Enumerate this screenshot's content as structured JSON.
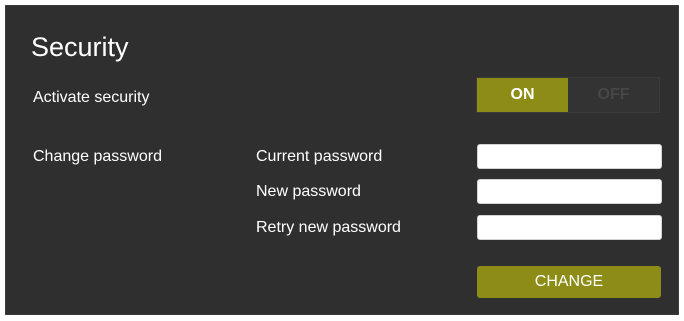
{
  "security": {
    "title": "Security",
    "activate_label": "Activate security",
    "toggle": {
      "on_label": "ON",
      "off_label": "OFF",
      "state": "ON"
    },
    "change_password_label": "Change password",
    "current_password_label": "Current password",
    "new_password_label": "New password",
    "retry_password_label": "Retry new password",
    "current_password_value": "",
    "new_password_value": "",
    "retry_password_value": "",
    "change_button_label": "CHANGE"
  },
  "colors": {
    "panel_background": "#2f2f2f",
    "accent": "#8c8c17",
    "toggle_off_text": "#474747",
    "text": "#ffffff"
  }
}
